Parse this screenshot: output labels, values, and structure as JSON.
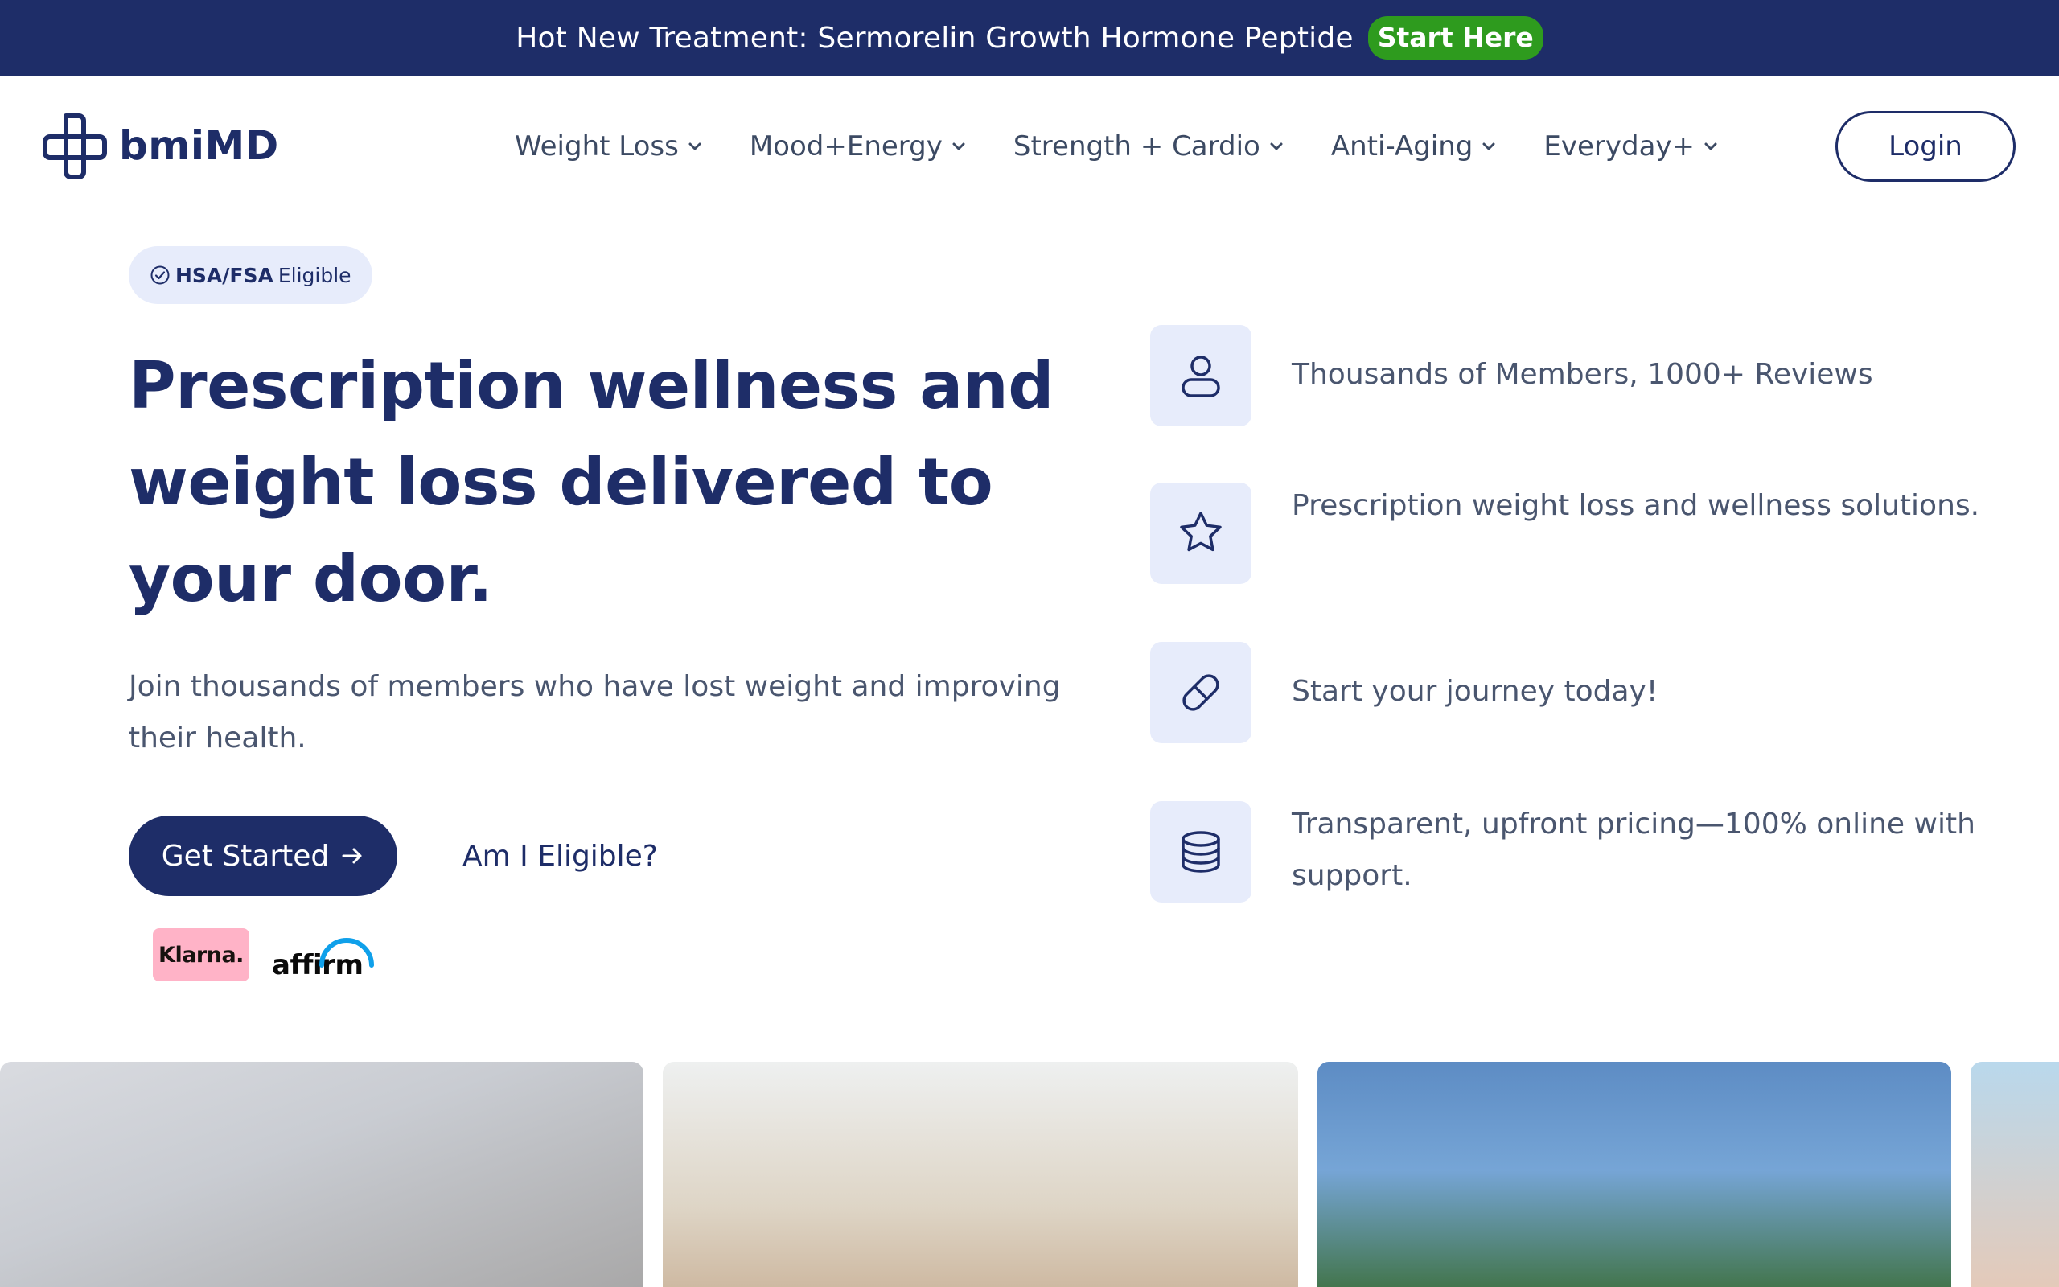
{
  "announcement": {
    "text": "Hot New Treatment: Sermorelin Growth Hormone Peptide",
    "cta_label": "Start Here"
  },
  "header": {
    "logo_text": "bmiMD",
    "nav": [
      {
        "label": "Weight Loss"
      },
      {
        "label": "Mood+Energy"
      },
      {
        "label": "Strength + Cardio"
      },
      {
        "label": "Anti-Aging"
      },
      {
        "label": "Everyday+"
      }
    ],
    "login_label": "Login"
  },
  "hero": {
    "badge_strong": "HSA/FSA",
    "badge_light": "Eligible",
    "title": "Prescription wellness and weight loss delivered to your door.",
    "subtitle": "Join thousands of members who have lost weight and improving their health.",
    "primary_cta": "Get Started",
    "secondary_cta": "Am I Eligible?",
    "payment_logos": [
      "Klarna.",
      "affirm"
    ]
  },
  "features": [
    {
      "icon": "user-icon",
      "text": "Thousands of Members, 1000+ Reviews"
    },
    {
      "icon": "star-icon",
      "text": "Prescription weight loss and wellness solutions."
    },
    {
      "icon": "pill-icon",
      "text": "Start your journey today!"
    },
    {
      "icon": "coins-icon",
      "text": "Transparent, upfront pricing—100% online with support."
    }
  ],
  "colors": {
    "navy": "#1e2d68",
    "announcement_bg": "#1e2d68",
    "start_here_green": "#2e9b1e",
    "icon_tile_bg": "#e7ecfb",
    "body_text": "#4a566f",
    "klarna_pink": "#ffb3c7",
    "affirm_blue": "#0fa0ea"
  }
}
